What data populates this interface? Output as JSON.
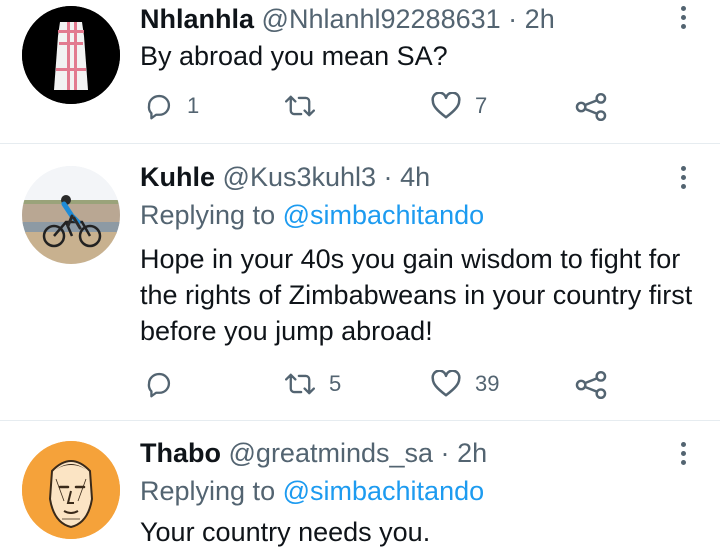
{
  "tweets": [
    {
      "name": "Nhlanhla",
      "handle": "@Nhlanhl92288631",
      "separator": "·",
      "time": "2h",
      "replying_prefix": "",
      "replying_to": "",
      "text": "By abroad you mean SA?",
      "replies": "1",
      "retweets": "",
      "likes": "7",
      "avatar": "dress-photo"
    },
    {
      "name": "Kuhle",
      "handle": "@Kus3kuhl3",
      "separator": "·",
      "time": "4h",
      "replying_prefix": "Replying to",
      "replying_to": "@simbachitando",
      "text": "Hope in your 40s you gain wisdom to fight for the rights of Zimbabweans in your country first before you jump abroad!",
      "replies": "",
      "retweets": "5",
      "likes": "39",
      "avatar": "cyclist-photo"
    },
    {
      "name": "Thabo",
      "handle": "@greatminds_sa",
      "separator": "·",
      "time": "2h",
      "replying_prefix": "Replying to",
      "replying_to": "@simbachitando",
      "text": "Your country needs you.",
      "replies": "",
      "retweets": "",
      "likes": "",
      "avatar": "face-sketch"
    }
  ],
  "icons": {
    "reply": "reply-icon",
    "retweet": "retweet-icon",
    "like": "like-icon",
    "share": "share-icon",
    "more": "more-options-icon"
  },
  "colors": {
    "text": "#0f1419",
    "secondary": "#536471",
    "link": "#1d9bf0",
    "divider": "#e6ecf0",
    "avatar_orange": "#f5a23a"
  }
}
